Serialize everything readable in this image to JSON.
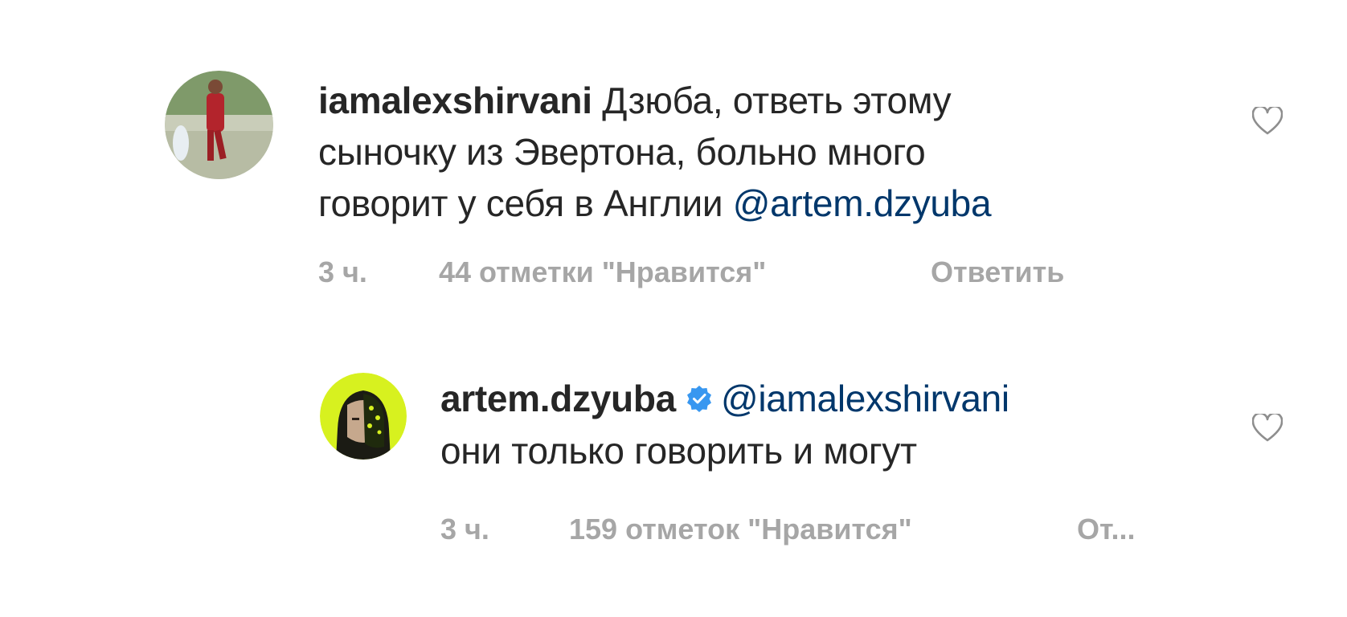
{
  "comments": [
    {
      "username": "iamalexshirvani",
      "text_lines": [
        "Дзюба, ответь этому",
        "сыночку из Эвертона, больно много",
        "говорит у себя в Англии "
      ],
      "mention": "@artem.dzyuba",
      "time": "3 ч.",
      "likes": "44 отметки \"Нравится\"",
      "reply_label": "Ответить",
      "like_icon": "heart-outline-icon"
    },
    {
      "username": "artem.dzyuba",
      "verified_icon": "verified-badge-icon",
      "mention": "@iamalexshirvani",
      "text_lines": [
        "они только говорить и могут"
      ],
      "time": "3 ч.",
      "likes": "159 отметок \"Нравится\"",
      "reply_label": "От...",
      "like_icon": "heart-outline-icon"
    }
  ],
  "colors": {
    "text": "#262626",
    "mention": "#00376b",
    "meta": "#a6a6a6",
    "verified": "#3897f0",
    "avatar2_bg": "#d7f11f"
  }
}
